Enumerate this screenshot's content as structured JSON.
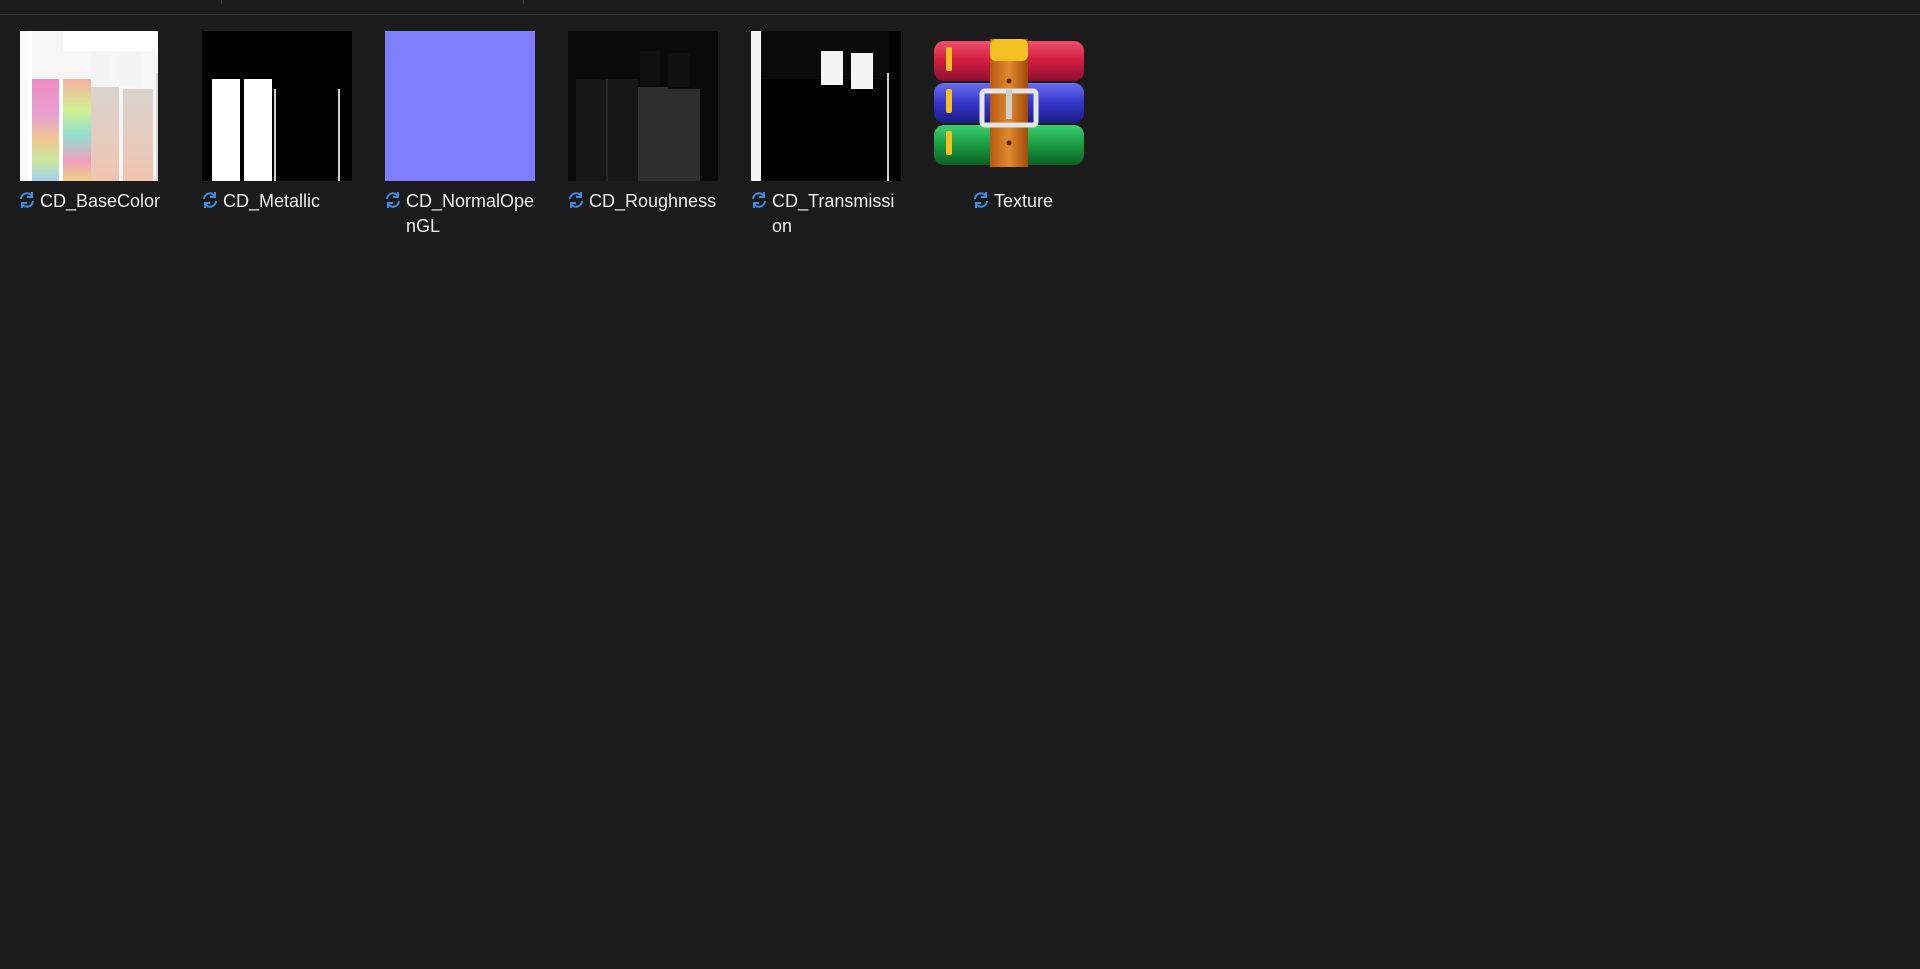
{
  "files": [
    {
      "name": "CD_BaseColor",
      "thumb": "basecolor-thumbnail",
      "status_icon": "sync-icon"
    },
    {
      "name": "CD_Metallic",
      "thumb": "metallic-thumbnail",
      "status_icon": "sync-icon"
    },
    {
      "name": "CD_NormalOpenGL",
      "thumb": "normal-thumbnail",
      "status_icon": "sync-icon"
    },
    {
      "name": "CD_Roughness",
      "thumb": "roughness-thumbnail",
      "status_icon": "sync-icon"
    },
    {
      "name": "CD_Transmission",
      "thumb": "transmission-thumbnail",
      "status_icon": "sync-icon"
    },
    {
      "name": "Texture",
      "thumb": "winrar-archive-icon",
      "status_icon": "sync-icon"
    }
  ],
  "colors": {
    "background": "#1b1b1b",
    "text": "#ececec",
    "sync_icon": "#3c8ee0",
    "normal_map": "#7f7fff"
  }
}
